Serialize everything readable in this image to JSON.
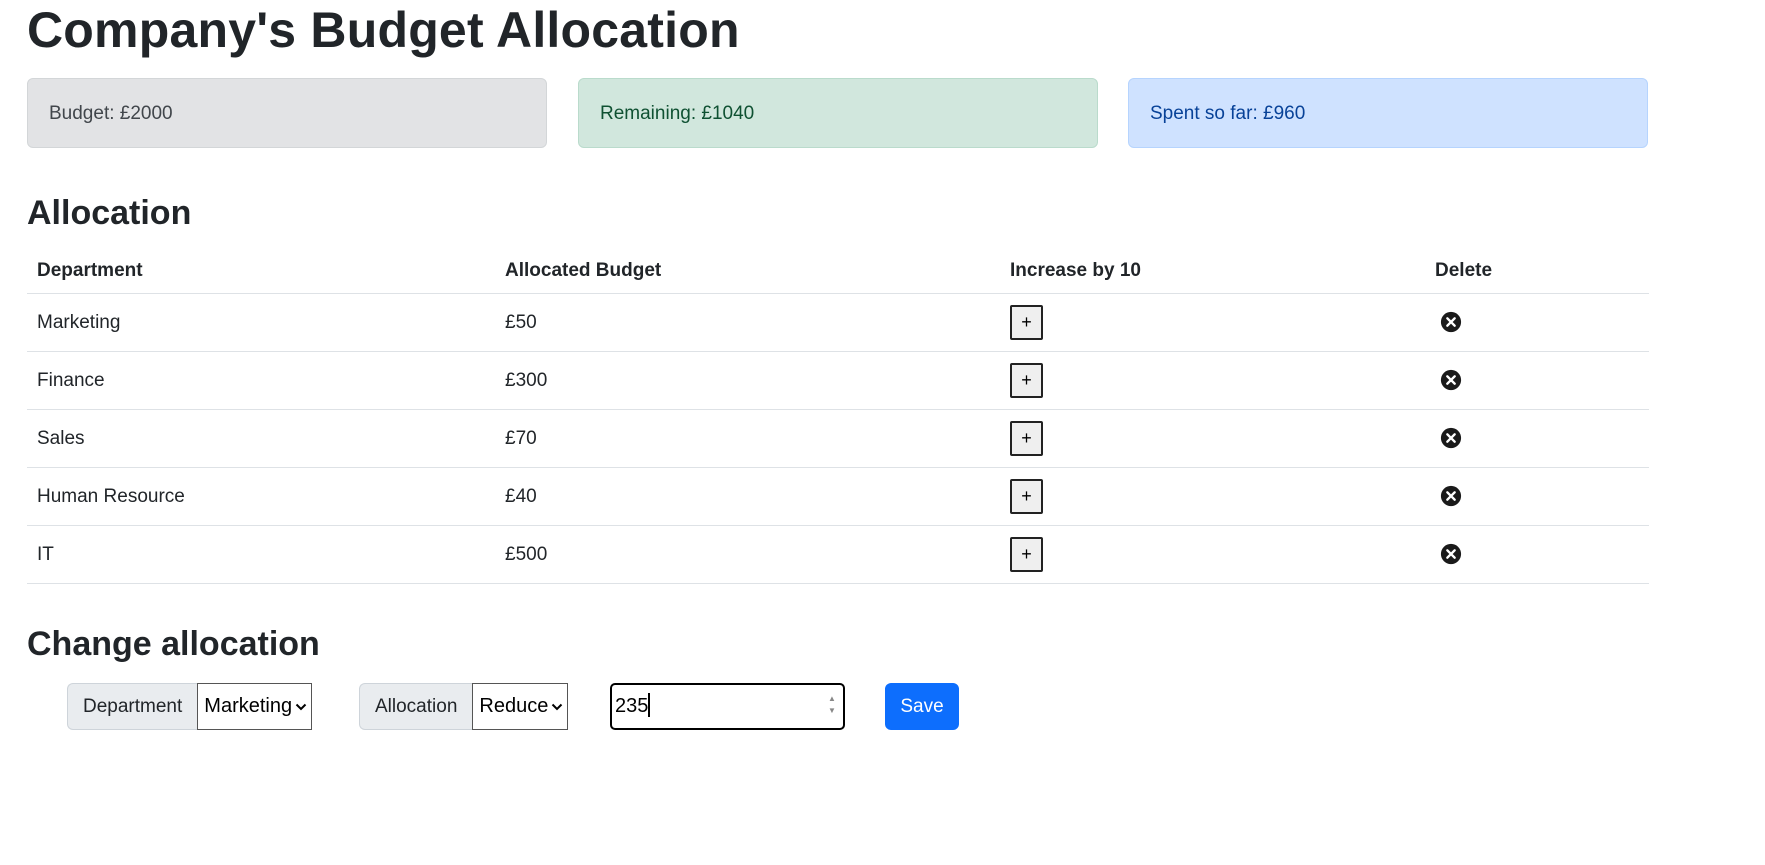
{
  "title": "Company's Budget Allocation",
  "summary": {
    "budget_text": "Budget: £2000",
    "remaining_text": "Remaining: £1040",
    "spent_text": "Spent so far: £960"
  },
  "allocation": {
    "heading": "Allocation",
    "columns": [
      "Department",
      "Allocated Budget",
      "Increase by 10",
      "Delete"
    ],
    "rows": [
      {
        "department": "Marketing",
        "budget": "£50",
        "increase_label": "+"
      },
      {
        "department": "Finance",
        "budget": "£300",
        "increase_label": "+"
      },
      {
        "department": "Sales",
        "budget": "£70",
        "increase_label": "+"
      },
      {
        "department": "Human Resource",
        "budget": "£40",
        "increase_label": "+"
      },
      {
        "department": "IT",
        "budget": "£500",
        "increase_label": "+"
      }
    ]
  },
  "change": {
    "heading": "Change allocation",
    "department_label": "Department",
    "department_value": "Marketing",
    "allocation_label": "Allocation",
    "allocation_value": "Reduce",
    "amount_value": "235",
    "save_label": "Save"
  },
  "icons": {
    "delete": "circle-x-icon",
    "select_arrow": "chevron-down-icon",
    "spinner": "spinner-arrows-icon"
  },
  "colors": {
    "primary": "#0d6efd",
    "budget_bg": "#e2e3e5",
    "remaining_bg": "#d1e7dd",
    "spent_bg": "#cfe2ff"
  }
}
